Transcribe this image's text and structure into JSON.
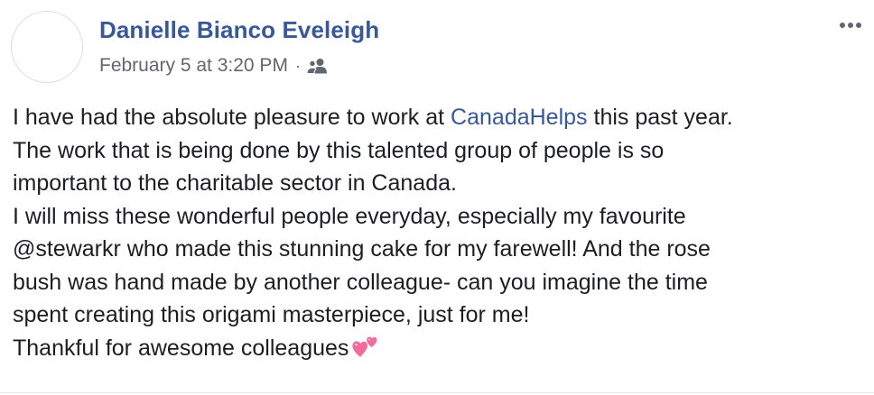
{
  "post": {
    "author": "Danielle Bianco Eveleigh",
    "timestamp": "February 5 at 3:20 PM",
    "separator": "·",
    "audience_icon": "friends-icon",
    "menu_icon": "more-options-icon",
    "emoji_icon": "two-hearts-icon",
    "link_color": "#385898",
    "body": {
      "line1_before": "I have had the absolute pleasure to work at ",
      "line1_link": "CanadaHelps",
      "line1_after": " this past year.",
      "line2": "The work that is being done by this talented group of people is so",
      "line3": "important to the charitable sector in Canada.",
      "line4": "I will miss these wonderful people everyday, especially my favourite",
      "line5": "@stewarkr who made this stunning cake for my farewell! And the rose",
      "line6": "bush was hand made by another colleague- can you imagine the time",
      "line7": "spent creating this origami masterpiece, just for me!",
      "line8": "Thankful for awesome colleagues"
    }
  }
}
